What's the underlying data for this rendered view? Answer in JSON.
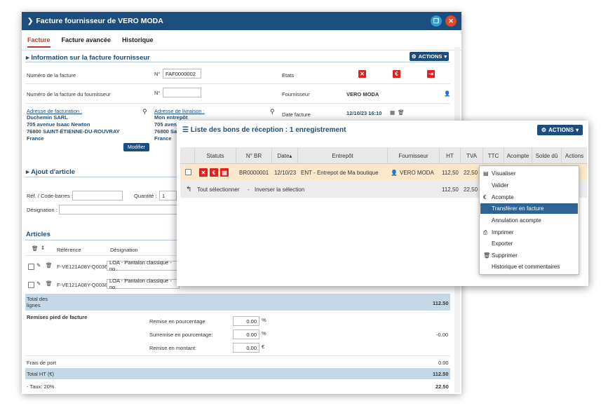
{
  "main": {
    "title": "Facture fournisseur de VERO MODA",
    "tabs": [
      "Facture",
      "Facture avancée",
      "Historique"
    ],
    "info_title": "Information sur la facture fournisseur",
    "actions_label": "ACTIONS",
    "label_num": "Numéro de la facture",
    "num_prefix": "N°",
    "num_value": "FAF0000002",
    "label_num_four": "Numéro de la facture du fournisseur",
    "label_etats": "Etats",
    "label_fournisseur": "Fournisseur",
    "fournisseur_value": "VERO MODA",
    "label_date": "Date facture",
    "date_value": "12/10/23 16:10",
    "billing_label": "Adresse de facturation :",
    "billing_lines": [
      "Duchemin SARL",
      "705 avenue Isaac Newton",
      "76800 SAINT-ÉTIENNE-DU-ROUVRAY",
      "France"
    ],
    "delivery_label": "Adresse de livraison :",
    "delivery_lines": [
      "Mon entrepôt",
      "705 avenue Isaac",
      "76800 Saint-Étie",
      "France"
    ],
    "modifier_label": "Modifier",
    "add_title": "Ajout d'article",
    "ref_label": "Réf. / Code-barres :",
    "qty_label": "Quantité :",
    "qty_value": "1",
    "desig_label": "Désignation :",
    "articles_title": "Articles",
    "col_ref": "Référence",
    "col_desig": "Désignation",
    "rows": [
      {
        "ref": "F-VE121A08Y-Q0036",
        "desig": "LOA - Pantalon classique - no"
      },
      {
        "ref": "F-VE121A08Y-Q0038",
        "desig": "LOA - Pantalon classique - no"
      }
    ],
    "total_lines_label": "Total des lignes",
    "total_lines_value": "112.50",
    "remises_label": "Remises pied de facture",
    "remise_pct_label": "Remise en pourcentage",
    "remise_pct_value": "0.00",
    "surremise_label": "Surremise en pourcentage:",
    "surremise_value": "0.00",
    "remise_mt_label": "Remise en montant:",
    "remise_mt_value": "0.00",
    "pct_unit": "%",
    "eur_unit": "€",
    "remises_total": "-0.00",
    "frais_label": "Frais de port",
    "frais_value": "0.00",
    "total_ht_label": "Total HT (€)",
    "total_ht_value": "112.50",
    "taux_label": "- Taux: 20%",
    "taux_value": "22.50"
  },
  "popup": {
    "title": "Liste des bons de réception : 1 enregistrement",
    "actions_label": "ACTIONS",
    "columns": [
      "Statuts",
      "N° BR",
      "Date▴",
      "Entrepôt",
      "Fournisseur",
      "HT",
      "TVA",
      "TTC",
      "Acompte",
      "Solde dû",
      "Actions"
    ],
    "row": {
      "br": "BR0000001",
      "date": "12/10/23",
      "entrepot": "ENT - Entrepot de Ma boutique",
      "fournisseur": "VERO MODA",
      "ht": "112,50",
      "tva": "22,50"
    },
    "select_all": "Tout sélectionner",
    "sep": "-",
    "invert": "Inverser la sélection",
    "foot_ht": "112,50",
    "foot_tva": "22,50"
  },
  "menu": {
    "items": [
      "Visualiser",
      "Valider",
      "Acompte",
      "Transférer en facture",
      "Annulation acompte",
      "Imprimer",
      "Exporter",
      "Supprimer",
      "Historique et commentaires"
    ]
  }
}
